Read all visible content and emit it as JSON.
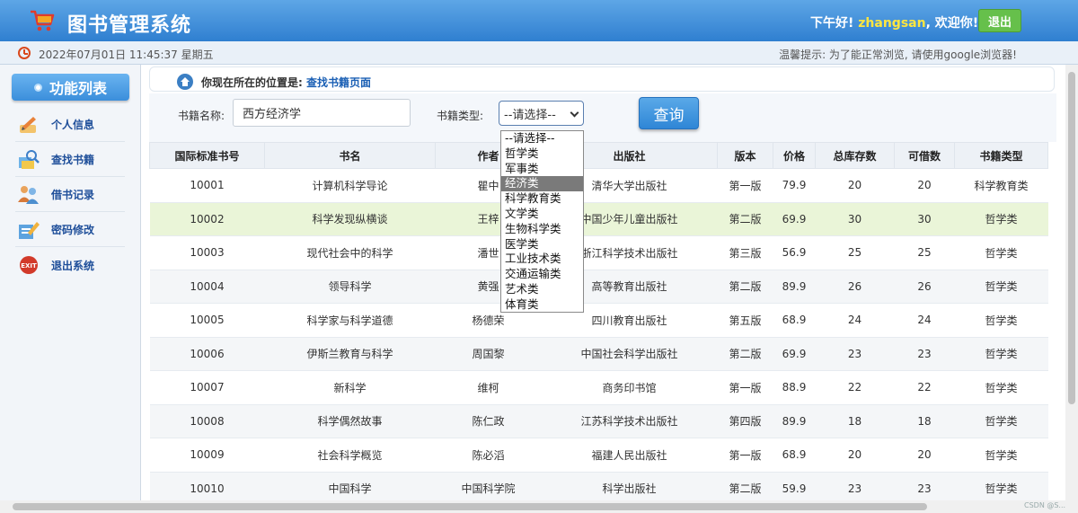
{
  "header": {
    "title": "图书管理系统",
    "greeting_prefix": "下午好! ",
    "username": "zhangsan",
    "greeting_suffix": ", 欢迎你!",
    "logout_label": "退出"
  },
  "subbar": {
    "datetime": "2022年07月01日 11:45:37 星期五",
    "tip": "温馨提示: 为了能正常浏览, 请使用google浏览器!"
  },
  "sidebar": {
    "title": "功能列表",
    "items": [
      {
        "label": "个人信息",
        "icon": "pencil-icon"
      },
      {
        "label": "查找书籍",
        "icon": "search-books-icon"
      },
      {
        "label": "借书记录",
        "icon": "users-icon"
      },
      {
        "label": "密码修改",
        "icon": "edit-password-icon"
      },
      {
        "label": "退出系统",
        "icon": "exit-icon"
      }
    ]
  },
  "breadcrumb": {
    "prefix": "你现在所在的位置是: ",
    "current": "查找书籍页面"
  },
  "search": {
    "name_label": "书籍名称:",
    "name_value": "西方经济学",
    "type_label": "书籍类型:",
    "type_selected": "--请选择--",
    "query_label": "查询",
    "type_options": [
      "--请选择--",
      "哲学类",
      "军事类",
      "经济类",
      "科学教育类",
      "文学类",
      "生物科学类",
      "医学类",
      "工业技术类",
      "交通运输类",
      "艺术类",
      "体育类"
    ],
    "highlighted_option": "经济类"
  },
  "table": {
    "headers": [
      "国际标准书号",
      "书名",
      "作者",
      "出版社",
      "版本",
      "价格",
      "总库存数",
      "可借数",
      "书籍类型"
    ],
    "rows": [
      [
        "10001",
        "计算机科学导论",
        "瞿中",
        "清华大学出版社",
        "第一版",
        "79.9",
        "20",
        "20",
        "科学教育类"
      ],
      [
        "10002",
        "科学发现纵横谈",
        "王梓",
        "中国少年儿童出版社",
        "第二版",
        "69.9",
        "30",
        "30",
        "哲学类"
      ],
      [
        "10003",
        "现代社会中的科学",
        "潘世",
        "浙江科学技术出版社",
        "第三版",
        "56.9",
        "25",
        "25",
        "哲学类"
      ],
      [
        "10004",
        "领导科学",
        "黄强",
        "高等教育出版社",
        "第二版",
        "89.9",
        "26",
        "26",
        "哲学类"
      ],
      [
        "10005",
        "科学家与科学道德",
        "杨德荣",
        "四川教育出版社",
        "第五版",
        "68.9",
        "24",
        "24",
        "哲学类"
      ],
      [
        "10006",
        "伊斯兰教育与科学",
        "周国黎",
        "中国社会科学出版社",
        "第二版",
        "69.9",
        "23",
        "23",
        "哲学类"
      ],
      [
        "10007",
        "新科学",
        "维柯",
        "商务印书馆",
        "第一版",
        "88.9",
        "22",
        "22",
        "哲学类"
      ],
      [
        "10008",
        "科学偶然故事",
        "陈仁政",
        "江苏科学技术出版社",
        "第四版",
        "89.9",
        "18",
        "18",
        "哲学类"
      ],
      [
        "10009",
        "社会科学概览",
        "陈必滔",
        "福建人民出版社",
        "第一版",
        "68.9",
        "20",
        "20",
        "哲学类"
      ],
      [
        "10010",
        "中国科学",
        "中国科学院",
        "科学出版社",
        "第二版",
        "59.9",
        "23",
        "23",
        "哲学类"
      ]
    ]
  },
  "watermark": "CSDN @S...",
  "colors": {
    "header_blue": "#2f7fd0",
    "username_yellow": "#ffe640",
    "logout_green": "#66c04b",
    "link_blue": "#1a5fb4",
    "highlight_row": "#eaf5d8"
  }
}
